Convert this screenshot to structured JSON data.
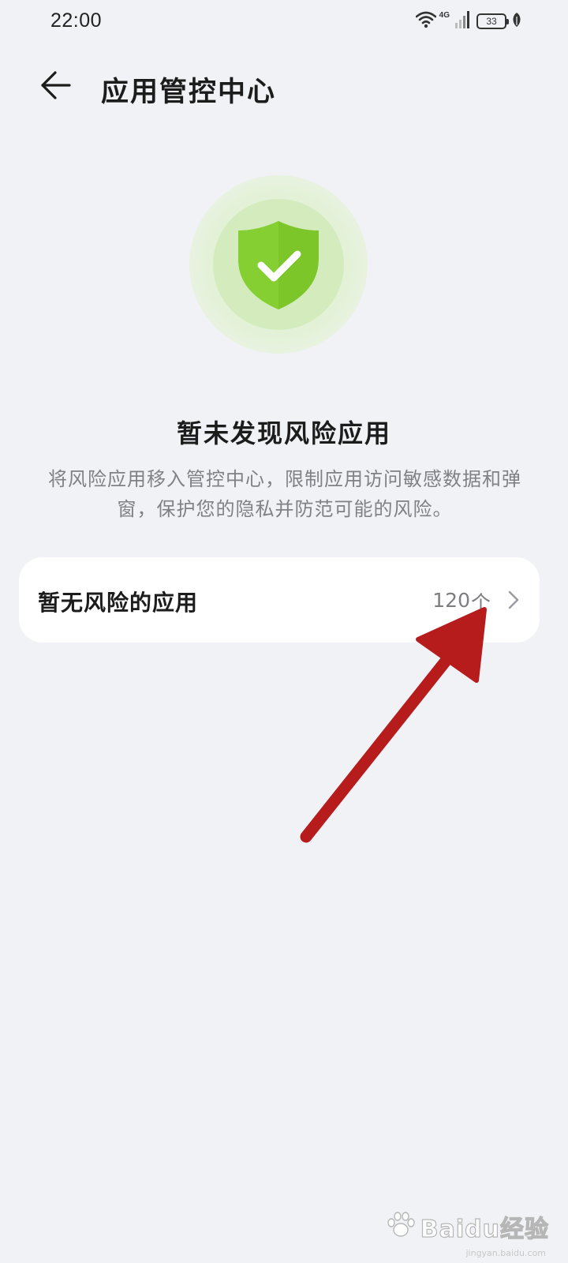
{
  "status_bar": {
    "time": "22:00",
    "network": "4G",
    "battery": "33",
    "icons": [
      "wifi-icon",
      "signal-icon",
      "battery-icon",
      "leaf-icon"
    ]
  },
  "header": {
    "back_icon": "arrow-left-icon",
    "title": "应用管控中心"
  },
  "hero": {
    "icon": "shield-check-icon",
    "title": "暂未发现风险应用",
    "description": "将风险应用移入管控中心，限制应用访问敏感数据和弹窗，保护您的隐私并防范可能的风险。"
  },
  "apps_row": {
    "label": "暂无风险的应用",
    "count": "120",
    "unit": "个",
    "icon": "chevron-right-icon"
  },
  "annotation": {
    "type": "arrow",
    "color": "#b71c1c"
  },
  "watermark": {
    "brand": "Baidu经验",
    "url": "jingyan.baidu.com"
  },
  "colors": {
    "background": "#f1f2f6",
    "card": "#ffffff",
    "shield_green": "#7cc62a",
    "secondary_text": "#808085"
  }
}
